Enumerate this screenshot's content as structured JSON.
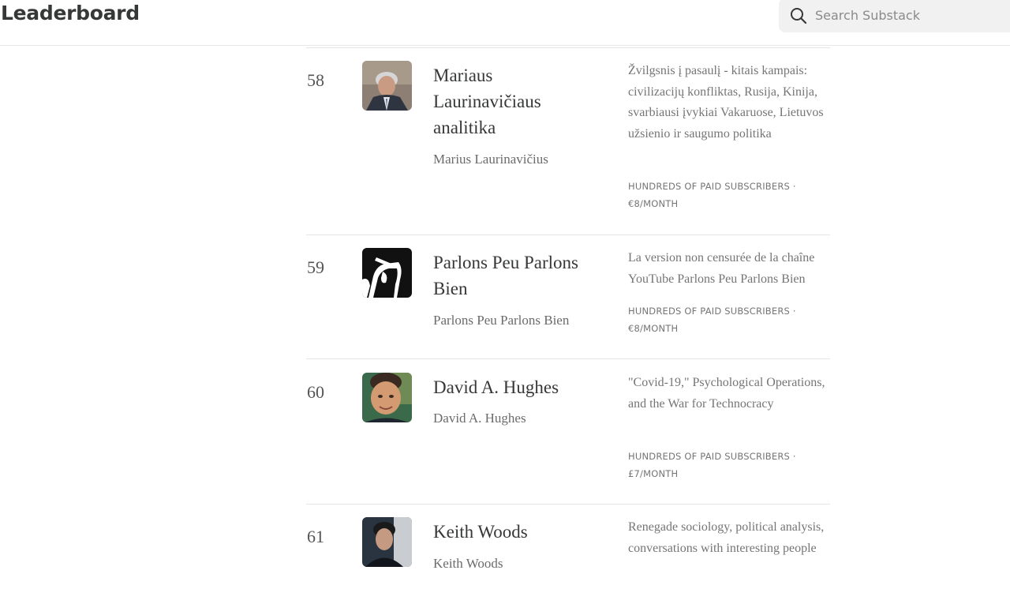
{
  "header": {
    "title": "Leaderboard",
    "search_placeholder": "Search Substack"
  },
  "entries": [
    {
      "rank": "58",
      "publication": "Mariaus Laurinavičiaus analitika",
      "author": "Marius Laurinavičius",
      "description": "Žvilgsnis į pasaulį - kitais kampais: civilizacijų konfliktas, Rusija, Kinija, svarbiausi įvykiai Vakaruose, Lietuvos užsienio ir saugumo politika",
      "meta": "Hundreds of paid subscribers · €8/month"
    },
    {
      "rank": "59",
      "publication": "Parlons Peu Parlons Bien",
      "author": "Parlons Peu Parlons Bien",
      "description": "La version non censurée de la chaîne YouTube Parlons Peu Parlons Bien",
      "meta": "Hundreds of paid subscribers · €8/month"
    },
    {
      "rank": "60",
      "publication": "David A. Hughes",
      "author": "David A. Hughes",
      "description": "\"Covid-19,\" Psychological Operations, and the War for Technocracy",
      "meta": "Hundreds of paid subscribers · £7/month"
    },
    {
      "rank": "61",
      "publication": "Keith Woods",
      "author": "Keith Woods",
      "description": "Renegade sociology, political analysis, conversations with interesting people",
      "meta": ""
    }
  ]
}
